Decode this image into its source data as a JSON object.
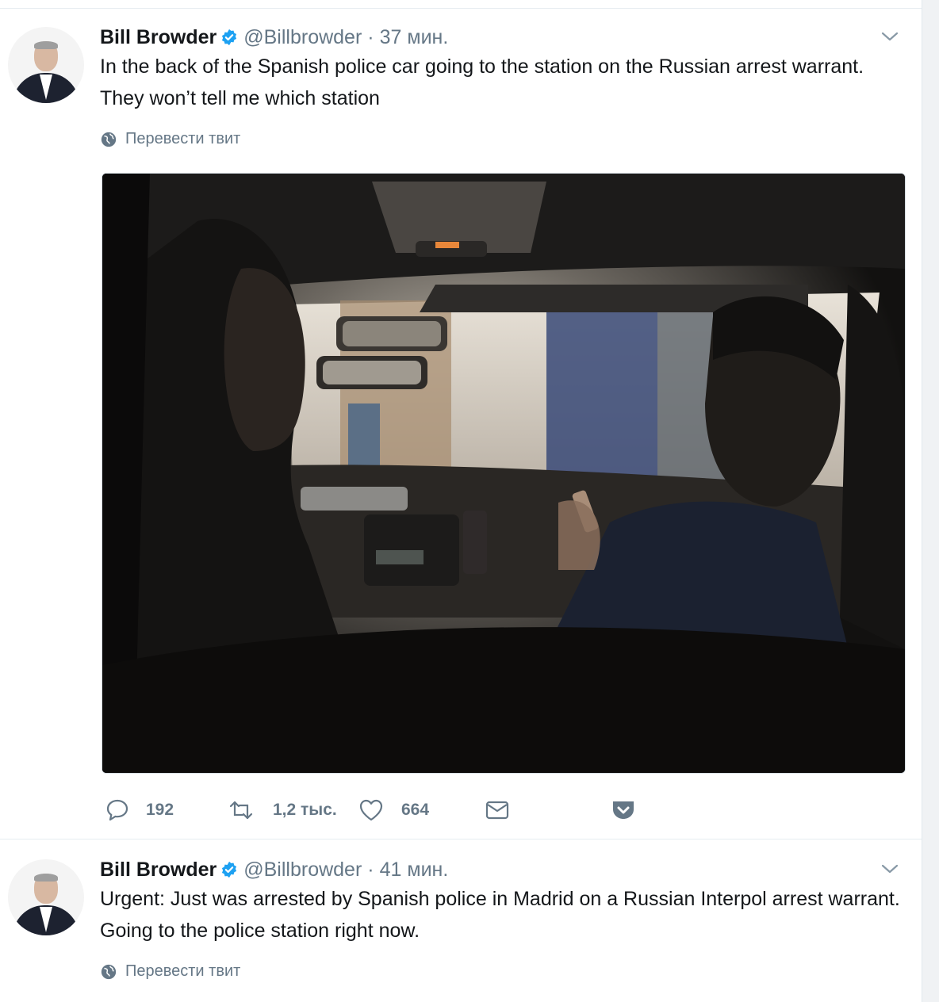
{
  "tweets": [
    {
      "name": "Bill Browder",
      "handle": "@Billbrowder",
      "separator": "·",
      "time": "37 мин.",
      "text": "In the back of the Spanish police car going to the station on the Russian arrest warrant. They won’t tell me which station",
      "translate_label": "Перевести твит",
      "replies": "192",
      "retweets": "1,2 тыс.",
      "likes": "664"
    },
    {
      "name": "Bill Browder",
      "handle": "@Billbrowder",
      "separator": "·",
      "time": "41 мин.",
      "text": "Urgent: Just was arrested by Spanish police in Madrid on a Russian Interpol arrest warrant. Going to the police station right now.",
      "translate_label": "Перевести твит"
    }
  ],
  "icons": {
    "verified": "verified-badge-icon",
    "chevron": "chevron-down-icon",
    "globe": "globe-icon",
    "reply": "reply-icon",
    "retweet": "retweet-icon",
    "like": "heart-icon",
    "dm": "envelope-icon",
    "pocket": "pocket-icon"
  },
  "colors": {
    "text": "#14171a",
    "secondary": "#657786",
    "verified": "#1da1f2",
    "pocket": "#657786"
  }
}
